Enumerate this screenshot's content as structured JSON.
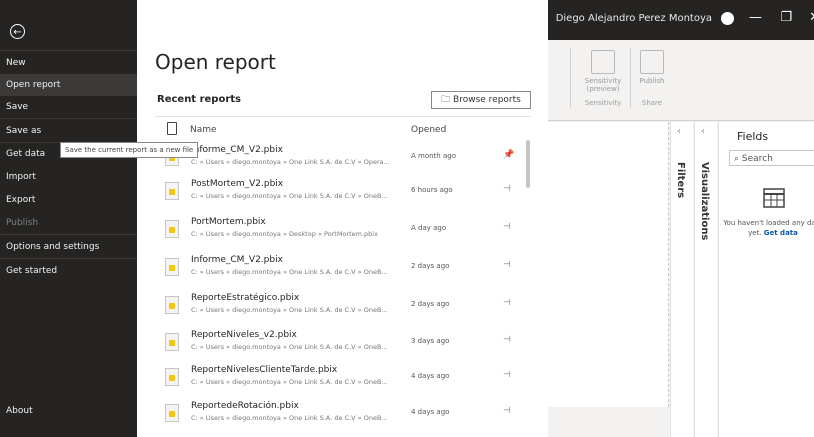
{
  "window": {
    "user": "Diego Alejandro Perez Montoya",
    "controls": [
      "—",
      "❐",
      "✕"
    ]
  },
  "nav": {
    "items": [
      {
        "label": "New",
        "active": false,
        "dim": false
      },
      {
        "label": "Open report",
        "active": true,
        "dim": false
      },
      {
        "label": "Save",
        "active": false,
        "dim": false
      },
      {
        "label": "Save as",
        "active": false,
        "dim": false
      },
      {
        "label": "Get data",
        "active": false,
        "dim": false
      },
      {
        "label": "Import",
        "active": false,
        "dim": false
      },
      {
        "label": "Export",
        "active": false,
        "dim": false
      },
      {
        "label": "Publish",
        "active": false,
        "dim": true
      },
      {
        "label": "Options and settings",
        "active": false,
        "dim": false
      },
      {
        "label": "Get started",
        "active": false,
        "dim": false
      }
    ],
    "about": "About",
    "tooltip": "Save the current report as a new file"
  },
  "main": {
    "title": "Open report",
    "subtitle": "Recent reports",
    "browse_label": "Browse reports",
    "col_name": "Name",
    "col_opened": "Opened",
    "files": [
      {
        "name": "Informe_CM_V2.pbix",
        "path": "C: » Users » diego.montoya » One Link S.A. de C.V » Opera...",
        "opened": "A month ago",
        "pinned": true
      },
      {
        "name": "PostMortem_V2.pbix",
        "path": "C: » Users » diego.montoya » One Link S.A. de C.V » OneB...",
        "opened": "6 hours ago",
        "pinned": false
      },
      {
        "name": "PortMortem.pbix",
        "path": "C: » Users » diego.montoya » Desktop » PortMortem.pbix",
        "opened": "A day ago",
        "pinned": false
      },
      {
        "name": "Informe_CM_V2.pbix",
        "path": "C: » Users » diego.montoya » One Link S.A. de C.V » OneB...",
        "opened": "2 days ago",
        "pinned": false
      },
      {
        "name": "ReporteEstratégico.pbix",
        "path": "C: » Users » diego.montoya » One Link S.A. de C.V » OneB...",
        "opened": "2 days ago",
        "pinned": false
      },
      {
        "name": "ReporteNiveles_v2.pbix",
        "path": "C: » Users » diego.montoya » One Link S.A. de C.V » OneB...",
        "opened": "3 days ago",
        "pinned": false
      },
      {
        "name": "ReporteNivelesClienteTarde.pbix",
        "path": "C: » Users » diego.montoya » One Link S.A. de C.V » OneB...",
        "opened": "4 days ago",
        "pinned": false
      },
      {
        "name": "ReportedeRotación.pbix",
        "path": "C: » Users » diego.montoya » One Link S.A. de C.V » OneB...",
        "opened": "4 days ago",
        "pinned": false
      }
    ]
  },
  "ribbon": {
    "groups": [
      {
        "label": "Sensitivity (preview)",
        "group": "Sensitivity"
      },
      {
        "label": "Publish",
        "group": "Share"
      }
    ]
  },
  "panes": {
    "filters": "Filters",
    "visualizations": "Visualizations",
    "fields_title": "Fields",
    "search_placeholder": "Search",
    "empty_msg": "You haven't loaded any data yet.",
    "get_data": "Get data"
  },
  "colors": {
    "sidebar": "#252423",
    "accent_yellow": "#f2c811",
    "link": "#0a58a8"
  }
}
